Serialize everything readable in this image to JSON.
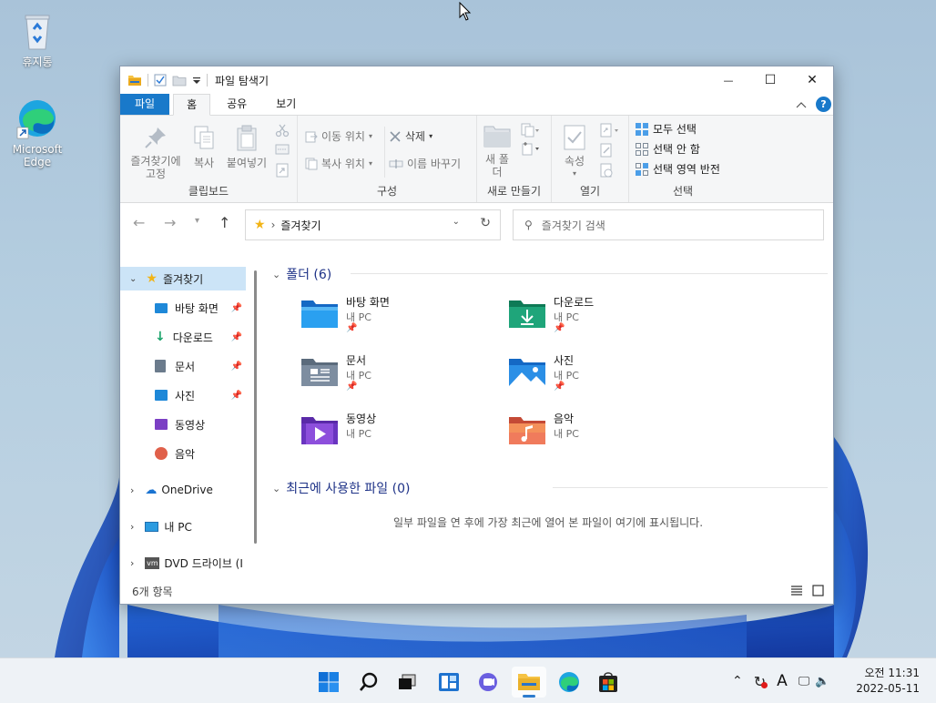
{
  "desktop": {
    "icons": [
      {
        "label": "휴지통",
        "icon": "recycle-bin-icon"
      },
      {
        "label": "Microsoft Edge",
        "icon": "edge-icon"
      }
    ]
  },
  "window": {
    "title": "파일 탐색기",
    "controls": {
      "minimize": "—",
      "maximize": "☐",
      "close": "✕"
    },
    "ribbon_tabs": [
      {
        "label": "파일",
        "active": false
      },
      {
        "label": "홈",
        "active": true
      },
      {
        "label": "공유",
        "active": false
      },
      {
        "label": "보기",
        "active": false
      }
    ],
    "help_label": "?",
    "ribbon": {
      "clipboard": {
        "pin_label": "즐겨찾기에 고정",
        "copy_label": "복사",
        "paste_label": "붙여넣기",
        "group_label": "클립보드"
      },
      "organize": {
        "move_label": "이동 위치",
        "copy_to_label": "복사 위치",
        "delete_label": "삭제",
        "rename_label": "이름 바꾸기",
        "group_label": "구성"
      },
      "new": {
        "new_folder_label": "새 폴더",
        "group_label": "새로 만들기"
      },
      "open": {
        "properties_label": "속성",
        "group_label": "열기"
      },
      "select": {
        "select_all_label": "모두 선택",
        "select_none_label": "선택 안 함",
        "invert_label": "선택 영역 반전",
        "group_label": "선택"
      }
    },
    "address": {
      "path": "즐겨찾기",
      "separator": "›"
    },
    "search": {
      "placeholder": "즐겨찾기 검색"
    },
    "nav_pane": {
      "quick_access": "즐겨찾기",
      "pinned": [
        {
          "label": "바탕 화면",
          "icon": "desktop-icon"
        },
        {
          "label": "다운로드",
          "icon": "download-icon"
        },
        {
          "label": "문서",
          "icon": "documents-icon"
        },
        {
          "label": "사진",
          "icon": "pictures-icon"
        },
        {
          "label": "동영상",
          "icon": "videos-icon"
        },
        {
          "label": "음악",
          "icon": "music-icon"
        }
      ],
      "onedrive": "OneDrive",
      "this_pc": "내 PC",
      "dvd": "DVD 드라이브 (I"
    },
    "content": {
      "folders_header": "폴더 (6)",
      "folders": [
        {
          "name": "바탕 화면",
          "sub": "내 PC",
          "icon": "desktop-folder-icon"
        },
        {
          "name": "다운로드",
          "sub": "내 PC",
          "icon": "downloads-folder-icon"
        },
        {
          "name": "문서",
          "sub": "내 PC",
          "icon": "documents-folder-icon"
        },
        {
          "name": "사진",
          "sub": "내 PC",
          "icon": "pictures-folder-icon"
        },
        {
          "name": "동영상",
          "sub": "내 PC",
          "icon": "videos-folder-icon"
        },
        {
          "name": "음악",
          "sub": "내 PC",
          "icon": "music-folder-icon"
        }
      ],
      "recent_header": "최근에 사용한 파일 (0)",
      "recent_empty": "일부 파일을 연 후에 가장 최근에 열어 본 파일이 여기에 표시됩니다."
    },
    "status": {
      "item_count": "6개 항목"
    }
  },
  "taskbar": {
    "apps": [
      {
        "name": "start",
        "icon": "windows-start-icon"
      },
      {
        "name": "search",
        "icon": "search-icon"
      },
      {
        "name": "task-view",
        "icon": "task-view-icon"
      },
      {
        "name": "widgets",
        "icon": "widgets-icon"
      },
      {
        "name": "chat",
        "icon": "teams-chat-icon"
      },
      {
        "name": "file-explorer",
        "icon": "file-explorer-icon",
        "active": true
      },
      {
        "name": "edge",
        "icon": "edge-icon"
      },
      {
        "name": "store",
        "icon": "store-icon"
      }
    ],
    "tray": {
      "ime_label": "A"
    },
    "clock": {
      "time": "오전 11:31",
      "date": "2022-05-11"
    }
  },
  "colors": {
    "accent": "#1979ca",
    "selection": "#cce4f7",
    "section_header": "#1e3287"
  }
}
